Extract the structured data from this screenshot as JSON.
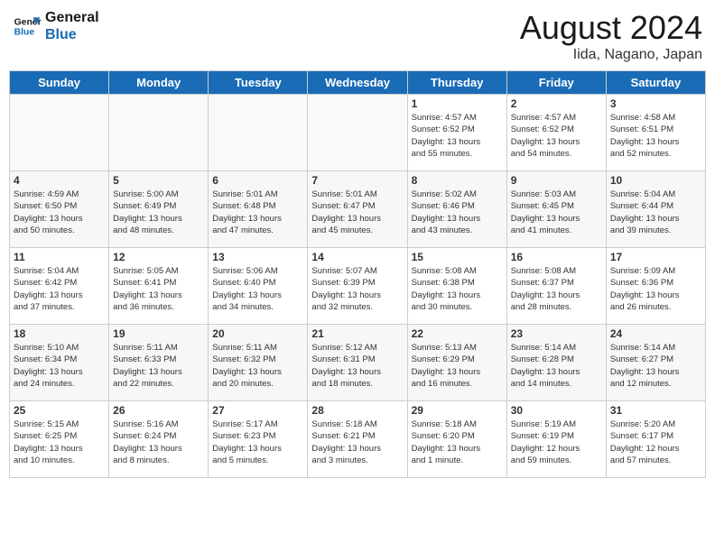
{
  "header": {
    "logo_line1": "General",
    "logo_line2": "Blue",
    "month": "August 2024",
    "location": "Iida, Nagano, Japan"
  },
  "weekdays": [
    "Sunday",
    "Monday",
    "Tuesday",
    "Wednesday",
    "Thursday",
    "Friday",
    "Saturday"
  ],
  "weeks": [
    [
      {
        "day": "",
        "info": ""
      },
      {
        "day": "",
        "info": ""
      },
      {
        "day": "",
        "info": ""
      },
      {
        "day": "",
        "info": ""
      },
      {
        "day": "1",
        "info": "Sunrise: 4:57 AM\nSunset: 6:52 PM\nDaylight: 13 hours\nand 55 minutes."
      },
      {
        "day": "2",
        "info": "Sunrise: 4:57 AM\nSunset: 6:52 PM\nDaylight: 13 hours\nand 54 minutes."
      },
      {
        "day": "3",
        "info": "Sunrise: 4:58 AM\nSunset: 6:51 PM\nDaylight: 13 hours\nand 52 minutes."
      }
    ],
    [
      {
        "day": "4",
        "info": "Sunrise: 4:59 AM\nSunset: 6:50 PM\nDaylight: 13 hours\nand 50 minutes."
      },
      {
        "day": "5",
        "info": "Sunrise: 5:00 AM\nSunset: 6:49 PM\nDaylight: 13 hours\nand 48 minutes."
      },
      {
        "day": "6",
        "info": "Sunrise: 5:01 AM\nSunset: 6:48 PM\nDaylight: 13 hours\nand 47 minutes."
      },
      {
        "day": "7",
        "info": "Sunrise: 5:01 AM\nSunset: 6:47 PM\nDaylight: 13 hours\nand 45 minutes."
      },
      {
        "day": "8",
        "info": "Sunrise: 5:02 AM\nSunset: 6:46 PM\nDaylight: 13 hours\nand 43 minutes."
      },
      {
        "day": "9",
        "info": "Sunrise: 5:03 AM\nSunset: 6:45 PM\nDaylight: 13 hours\nand 41 minutes."
      },
      {
        "day": "10",
        "info": "Sunrise: 5:04 AM\nSunset: 6:44 PM\nDaylight: 13 hours\nand 39 minutes."
      }
    ],
    [
      {
        "day": "11",
        "info": "Sunrise: 5:04 AM\nSunset: 6:42 PM\nDaylight: 13 hours\nand 37 minutes."
      },
      {
        "day": "12",
        "info": "Sunrise: 5:05 AM\nSunset: 6:41 PM\nDaylight: 13 hours\nand 36 minutes."
      },
      {
        "day": "13",
        "info": "Sunrise: 5:06 AM\nSunset: 6:40 PM\nDaylight: 13 hours\nand 34 minutes."
      },
      {
        "day": "14",
        "info": "Sunrise: 5:07 AM\nSunset: 6:39 PM\nDaylight: 13 hours\nand 32 minutes."
      },
      {
        "day": "15",
        "info": "Sunrise: 5:08 AM\nSunset: 6:38 PM\nDaylight: 13 hours\nand 30 minutes."
      },
      {
        "day": "16",
        "info": "Sunrise: 5:08 AM\nSunset: 6:37 PM\nDaylight: 13 hours\nand 28 minutes."
      },
      {
        "day": "17",
        "info": "Sunrise: 5:09 AM\nSunset: 6:36 PM\nDaylight: 13 hours\nand 26 minutes."
      }
    ],
    [
      {
        "day": "18",
        "info": "Sunrise: 5:10 AM\nSunset: 6:34 PM\nDaylight: 13 hours\nand 24 minutes."
      },
      {
        "day": "19",
        "info": "Sunrise: 5:11 AM\nSunset: 6:33 PM\nDaylight: 13 hours\nand 22 minutes."
      },
      {
        "day": "20",
        "info": "Sunrise: 5:11 AM\nSunset: 6:32 PM\nDaylight: 13 hours\nand 20 minutes."
      },
      {
        "day": "21",
        "info": "Sunrise: 5:12 AM\nSunset: 6:31 PM\nDaylight: 13 hours\nand 18 minutes."
      },
      {
        "day": "22",
        "info": "Sunrise: 5:13 AM\nSunset: 6:29 PM\nDaylight: 13 hours\nand 16 minutes."
      },
      {
        "day": "23",
        "info": "Sunrise: 5:14 AM\nSunset: 6:28 PM\nDaylight: 13 hours\nand 14 minutes."
      },
      {
        "day": "24",
        "info": "Sunrise: 5:14 AM\nSunset: 6:27 PM\nDaylight: 13 hours\nand 12 minutes."
      }
    ],
    [
      {
        "day": "25",
        "info": "Sunrise: 5:15 AM\nSunset: 6:25 PM\nDaylight: 13 hours\nand 10 minutes."
      },
      {
        "day": "26",
        "info": "Sunrise: 5:16 AM\nSunset: 6:24 PM\nDaylight: 13 hours\nand 8 minutes."
      },
      {
        "day": "27",
        "info": "Sunrise: 5:17 AM\nSunset: 6:23 PM\nDaylight: 13 hours\nand 5 minutes."
      },
      {
        "day": "28",
        "info": "Sunrise: 5:18 AM\nSunset: 6:21 PM\nDaylight: 13 hours\nand 3 minutes."
      },
      {
        "day": "29",
        "info": "Sunrise: 5:18 AM\nSunset: 6:20 PM\nDaylight: 13 hours\nand 1 minute."
      },
      {
        "day": "30",
        "info": "Sunrise: 5:19 AM\nSunset: 6:19 PM\nDaylight: 12 hours\nand 59 minutes."
      },
      {
        "day": "31",
        "info": "Sunrise: 5:20 AM\nSunset: 6:17 PM\nDaylight: 12 hours\nand 57 minutes."
      }
    ]
  ]
}
